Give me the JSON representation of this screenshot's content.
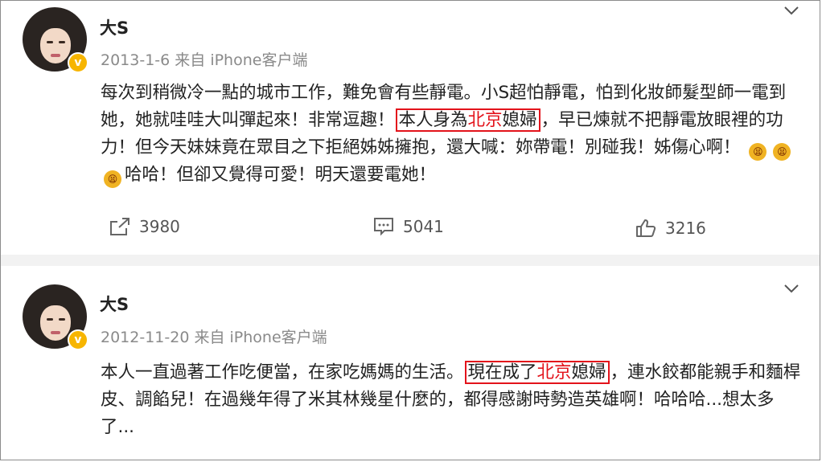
{
  "posts": [
    {
      "author": "大S",
      "meta": "2013-1-6 来自 iPhone客户端",
      "verified_badge": "v",
      "text": {
        "before": "每次到稍微冷一點的城市工作，難免會有些靜電。小S超怕靜電，怕到化妝師髮型師一電到她，她就哇哇大叫彈起來！非常逗趣！",
        "highlight_pre": "本人身為",
        "highlight_red": "北京",
        "highlight_post": "媳婦",
        "after": "，早已煉就不把靜電放眼裡的功力！但今天妹妹竟在眾目之下拒絕姊姊擁抱，還大喊：妳帶電！別碰我！姊傷心啊！",
        "after_emoji": "哈哈！但卻又覺得可愛！明天還要電她！"
      },
      "emojis": [
        "😫",
        "😫",
        "😫"
      ],
      "actions": {
        "share": "3980",
        "comment": "5041",
        "like": "3216"
      }
    },
    {
      "author": "大S",
      "meta": "2012-11-20 来自 iPhone客户端",
      "verified_badge": "v",
      "text": {
        "before": "本人一直過著工作吃便當，在家吃媽媽的生活。",
        "highlight_pre": "現在成了",
        "highlight_red": "北京",
        "highlight_post": "媳婦",
        "after": "，連水餃都能親手和麵桿皮、調餡兒！在過幾年得了米其林幾星什麼的，都得感謝時勢造英雄啊！哈哈哈...想太多了..."
      }
    }
  ],
  "icons": {
    "share": "share-icon",
    "comment": "comment-icon",
    "like": "thumbs-up-icon",
    "more": "chevron-down-icon"
  },
  "colors": {
    "highlight": "#e3131b",
    "verified": "#f7b500",
    "separator": "#f2f2f2"
  }
}
